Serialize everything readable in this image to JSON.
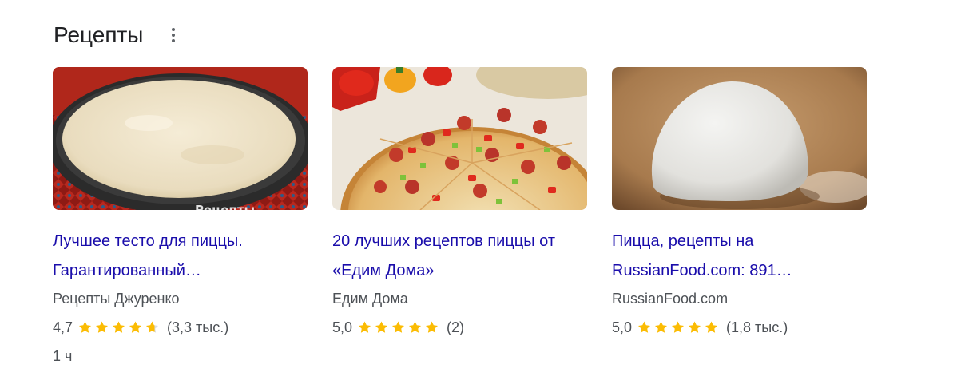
{
  "section": {
    "title": "Рецепты"
  },
  "colors": {
    "link": "#1a0dab",
    "star": "#fbbc04",
    "star_empty": "#dadce0",
    "meta": "#4d5156"
  },
  "cards": [
    {
      "title": "Лучшее тесто для пиццы. Гарантированный…",
      "source": "Рецепты Джуренко",
      "rating": "4,7",
      "rating_value": 4.7,
      "reviews": "(3,3 тыс.)",
      "duration": "1 ч",
      "image_icon": "pizza-dough-in-pan-image",
      "image_watermark": "Рецепты"
    },
    {
      "title": "20 лучших рецептов пиццы от «Едим Дома»",
      "source": "Едим Дома",
      "rating": "5,0",
      "rating_value": 5.0,
      "reviews": "(2)",
      "image_icon": "pepperoni-pizza-image"
    },
    {
      "title": "Пицца, рецепты на RussianFood.com: 891…",
      "source": "RussianFood.com",
      "rating": "5,0",
      "rating_value": 5.0,
      "reviews": "(1,8 тыс.)",
      "image_icon": "dough-ball-image"
    }
  ]
}
